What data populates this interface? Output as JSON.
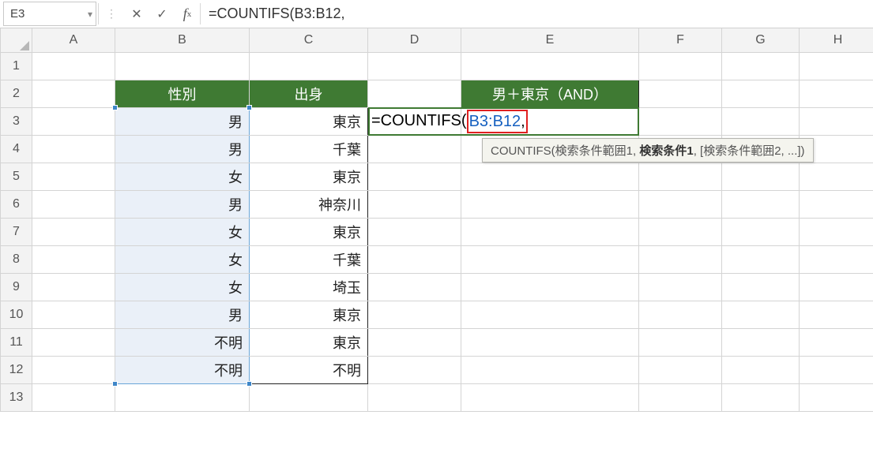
{
  "namebox": {
    "value": "E3"
  },
  "formula_bar": {
    "text": "=COUNTIFS(B3:B12,"
  },
  "columns": [
    "A",
    "B",
    "C",
    "D",
    "E",
    "F",
    "G",
    "H"
  ],
  "active_column_index": 4,
  "rows": [
    1,
    2,
    3,
    4,
    5,
    6,
    7,
    8,
    9,
    10,
    11,
    12,
    13
  ],
  "active_row_index": 2,
  "headers": {
    "B2": "性別",
    "C2": "出身",
    "E2": "男＋東京（AND）"
  },
  "dataB": [
    "男",
    "男",
    "女",
    "男",
    "女",
    "女",
    "女",
    "男",
    "不明",
    "不明"
  ],
  "dataC": [
    "東京",
    "千葉",
    "東京",
    "神奈川",
    "東京",
    "千葉",
    "埼玉",
    "東京",
    "東京",
    "不明"
  ],
  "editing": {
    "prefix": "=COUNTIFS(",
    "ref": "B3:B12",
    "suffix": ","
  },
  "tooltip": {
    "fn": "COUNTIFS",
    "arg1": "検索条件範囲1",
    "arg2_bold": "検索条件1",
    "rest": ", [検索条件範囲2, ...])"
  }
}
